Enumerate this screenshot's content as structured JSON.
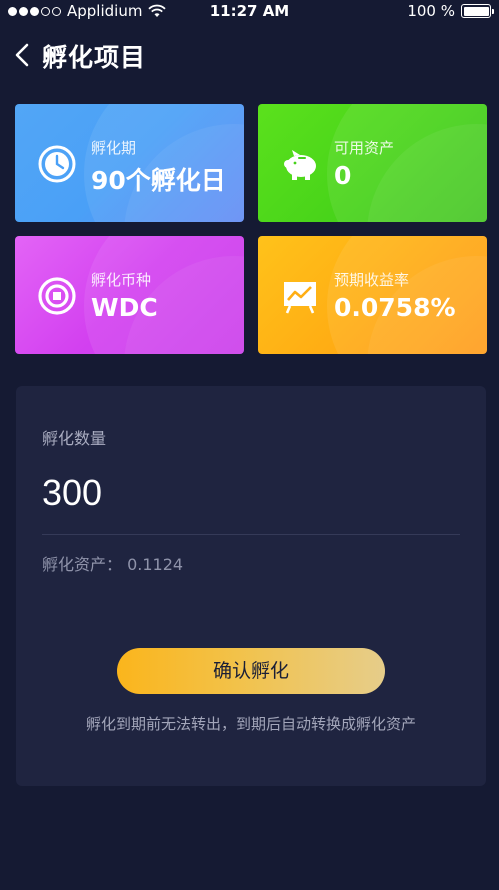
{
  "status_bar": {
    "carrier": "Applidium",
    "time": "11:27 AM",
    "battery": "100 %"
  },
  "header": {
    "title": "孵化项目",
    "back_icon": "chevron-left-icon"
  },
  "cards": [
    {
      "label": "孵化期",
      "value": "90个孵化日",
      "icon": "clock-icon",
      "color": "#4aa0f7"
    },
    {
      "label": "可用资产",
      "value": "0",
      "icon": "piggy-bank-icon",
      "color": "#46d21a"
    },
    {
      "label": "孵化币种",
      "value": "WDC",
      "icon": "coin-icon",
      "color": "#d341f0"
    },
    {
      "label": "预期收益率",
      "value": "0.0758%",
      "icon": "chart-board-icon",
      "color": "#ffae14"
    }
  ],
  "panel": {
    "quantity_label": "孵化数量",
    "quantity_value": "300",
    "asset_text": "孵化资产：  0.1124",
    "confirm_label": "确认孵化",
    "note": "孵化到期前无法转出，到期后自动转换成孵化资产"
  },
  "colors": {
    "background": "#151a33",
    "panel": "#1f2440",
    "button_start": "#fbb51c",
    "button_end": "#e6cd8a"
  }
}
